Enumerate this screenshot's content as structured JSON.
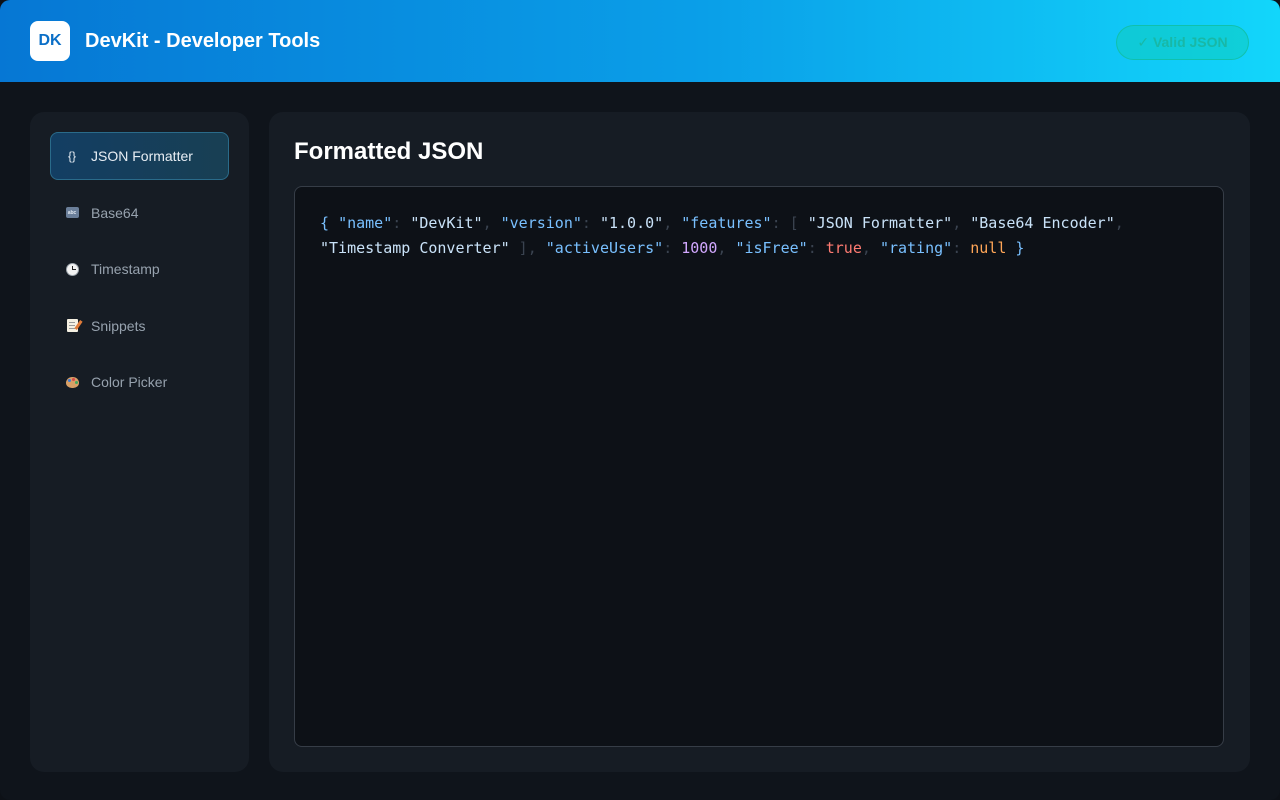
{
  "header": {
    "logo_text": "DK",
    "title": "DevKit - Developer Tools",
    "status_badge": "✓ Valid JSON"
  },
  "sidebar": {
    "items": [
      {
        "icon": "braces-icon",
        "icon_glyph": "{}",
        "label": "JSON Formatter",
        "active": true
      },
      {
        "icon": "abc-input-icon",
        "icon_glyph": "abc",
        "label": "Base64",
        "active": false
      },
      {
        "icon": "clock-icon",
        "icon_glyph": "",
        "label": "Timestamp",
        "active": false
      },
      {
        "icon": "memo-icon",
        "icon_glyph": "",
        "label": "Snippets",
        "active": false
      },
      {
        "icon": "palette-icon",
        "icon_glyph": "",
        "label": "Color Picker",
        "active": false
      }
    ]
  },
  "main": {
    "title": "Formatted JSON",
    "code_tokens": [
      {
        "t": "{",
        "c": "brace"
      },
      {
        "t": " ",
        "c": "ws"
      },
      {
        "t": "\"name\"",
        "c": "key"
      },
      {
        "t": ": ",
        "c": "punc"
      },
      {
        "t": "\"DevKit\"",
        "c": "str"
      },
      {
        "t": ", ",
        "c": "punc"
      },
      {
        "t": "\"version\"",
        "c": "key"
      },
      {
        "t": ": ",
        "c": "punc"
      },
      {
        "t": "\"1.0.0\"",
        "c": "str"
      },
      {
        "t": ", ",
        "c": "punc"
      },
      {
        "t": "\"features\"",
        "c": "key"
      },
      {
        "t": ": ",
        "c": "punc"
      },
      {
        "t": "[ ",
        "c": "punc"
      },
      {
        "t": "\"JSON Formatter\"",
        "c": "str"
      },
      {
        "t": ", ",
        "c": "punc"
      },
      {
        "t": "\"Base64 Encoder\"",
        "c": "str"
      },
      {
        "t": ", ",
        "c": "punc"
      },
      {
        "t": "\"Timestamp Converter\"",
        "c": "str"
      },
      {
        "t": " ]",
        "c": "punc"
      },
      {
        "t": ", ",
        "c": "punc"
      },
      {
        "t": "\"activeUsers\"",
        "c": "key"
      },
      {
        "t": ": ",
        "c": "punc"
      },
      {
        "t": "1000",
        "c": "num"
      },
      {
        "t": ", ",
        "c": "punc"
      },
      {
        "t": "\"isFree\"",
        "c": "key"
      },
      {
        "t": ": ",
        "c": "punc"
      },
      {
        "t": "true",
        "c": "bool"
      },
      {
        "t": ", ",
        "c": "punc"
      },
      {
        "t": "\"rating\"",
        "c": "key"
      },
      {
        "t": ": ",
        "c": "punc"
      },
      {
        "t": "null",
        "c": "null"
      },
      {
        "t": " ",
        "c": "ws"
      },
      {
        "t": "}",
        "c": "brace"
      }
    ]
  },
  "colors": {
    "header_gradient_start": "#0677d4",
    "header_gradient_end": "#12d6fb",
    "background": "#0f141b",
    "panel": "#161c24",
    "code_bg": "#0d1117",
    "json_key": "#79c0ff",
    "json_string": "#c9e2f8",
    "json_number": "#d2a8ff",
    "json_boolean": "#ff7b72",
    "json_null": "#ffa657"
  }
}
